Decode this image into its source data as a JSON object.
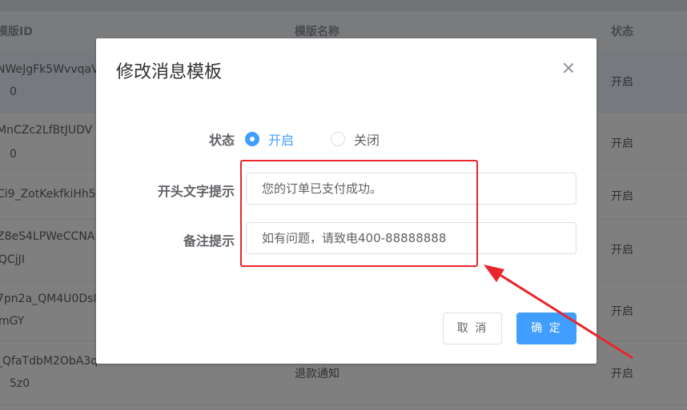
{
  "table": {
    "headers": {
      "id": "模版ID",
      "name": "模版名称",
      "status": "状态"
    },
    "rows": [
      {
        "id_line1": "NWeJgFk5WvvqaV",
        "id_line2": "0",
        "name": "",
        "status": "开启"
      },
      {
        "id_line1": "MnCZc2LfBtJUDV",
        "id_line2": "0",
        "name": "",
        "status": "开启"
      },
      {
        "id_line1": "Ci9_ZotKekfkiHh5",
        "id_line2": "",
        "name": "",
        "status": "开启"
      },
      {
        "id_line1": "Z8eS4LPWeCCNA",
        "id_line2": "QCjJI",
        "name": "",
        "status": "开启"
      },
      {
        "id_line1": "7pn2a_QM4U0DsI",
        "id_line2": "mGY",
        "name": "",
        "status": "开启"
      },
      {
        "id_line1": "_QfaTdbM2ObA3q",
        "id_line2": "5z0",
        "name": "退款通知",
        "status": "开启"
      }
    ]
  },
  "dialog": {
    "title": "修改消息模板",
    "status_label": "状态",
    "radio_on": "开启",
    "radio_off": "关闭",
    "status_selected": "开启",
    "header_label": "开头文字提示",
    "header_value": "您的订单已支付成功。",
    "remark_label": "备注提示",
    "remark_value": "如有问题，请致电400-88888888",
    "cancel_label": "取 消",
    "confirm_label": "确 定"
  },
  "colors": {
    "primary": "#409eff",
    "annotation": "#e8262b"
  },
  "icons": {
    "close": "close-icon"
  }
}
